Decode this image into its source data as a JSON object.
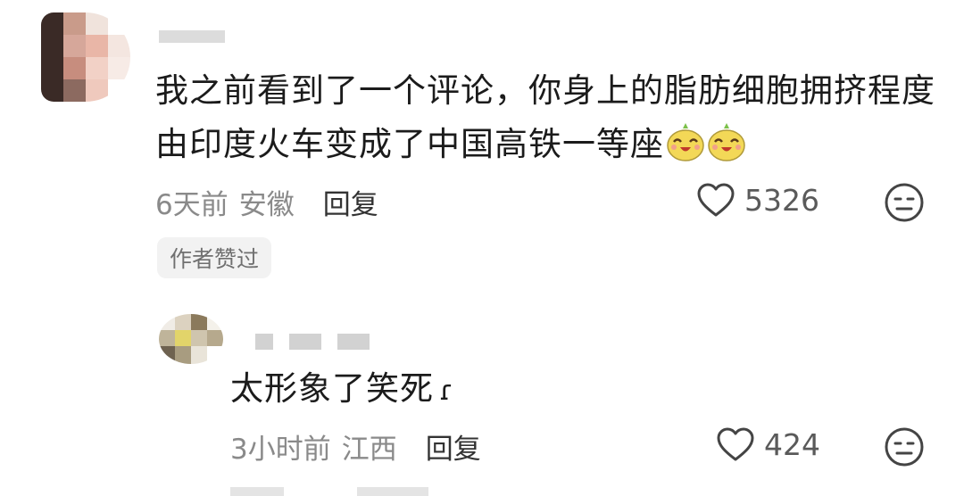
{
  "comment": {
    "line1": "我之前看到了一个评论，你身上的脂肪细胞拥挤程度",
    "line2": "由印度火车变成了中国高铁一等座",
    "time": "6天前",
    "location": "安徽",
    "reply_label": "回复",
    "like_count": "5326",
    "badge": "作者赞过"
  },
  "reply": {
    "text": "太形象了笑死",
    "time": "3小时前",
    "location": "江西",
    "reply_label": "回复",
    "like_count": "424"
  },
  "icons": {
    "like": "heart-outline-icon",
    "dislike": "neutral-face-icon",
    "emoji": "laughing-pear-emoji"
  }
}
